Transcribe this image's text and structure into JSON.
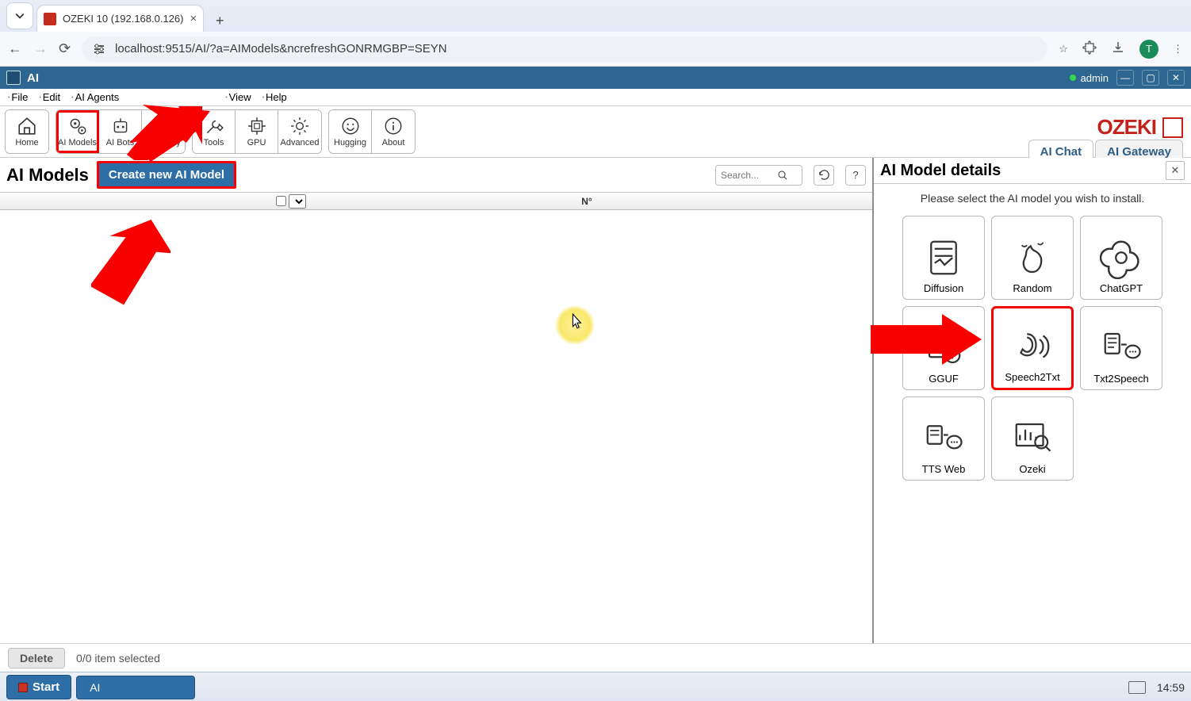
{
  "browser": {
    "tab_title": "OZEKI 10 (192.168.0.126)",
    "url": "localhost:9515/AI/?a=AIModels&ncrefreshGONRMGBP=SEYN",
    "profile_initial": "T"
  },
  "app": {
    "window_title": "AI",
    "user": "admin",
    "brand_name": "OZEKI",
    "brand_url": "www.myozeki.com"
  },
  "menu": {
    "file": "File",
    "edit": "Edit",
    "ai_agents": "AI Agents",
    "view": "View",
    "help": "Help"
  },
  "toolbar": {
    "home": "Home",
    "ai_models": "AI Models",
    "ai_bots": "AI Bots",
    "gateway": "Gateway",
    "tools": "Tools",
    "gpu": "GPU",
    "advanced": "Advanced",
    "hugging": "Hugging",
    "about": "About"
  },
  "header_tabs": {
    "ai_chat": "AI Chat",
    "ai_gateway": "AI Gateway"
  },
  "left": {
    "title": "AI Models",
    "create_btn": "Create new AI Model",
    "search_placeholder": "Search...",
    "col_no": "N°"
  },
  "details": {
    "title": "AI Model details",
    "message": "Please select the AI model you wish to install.",
    "models": {
      "diffusion": "Diffusion",
      "random": "Random",
      "chatgpt": "ChatGPT",
      "gguf": "GGUF",
      "speech2txt": "Speech2Txt",
      "txt2speech": "Txt2Speech",
      "tts_web": "TTS Web",
      "ozeki": "Ozeki"
    }
  },
  "footer": {
    "delete": "Delete",
    "selection": "0/0 item selected"
  },
  "taskbar": {
    "start": "Start",
    "task_ai": "AI",
    "clock": "14:59"
  }
}
